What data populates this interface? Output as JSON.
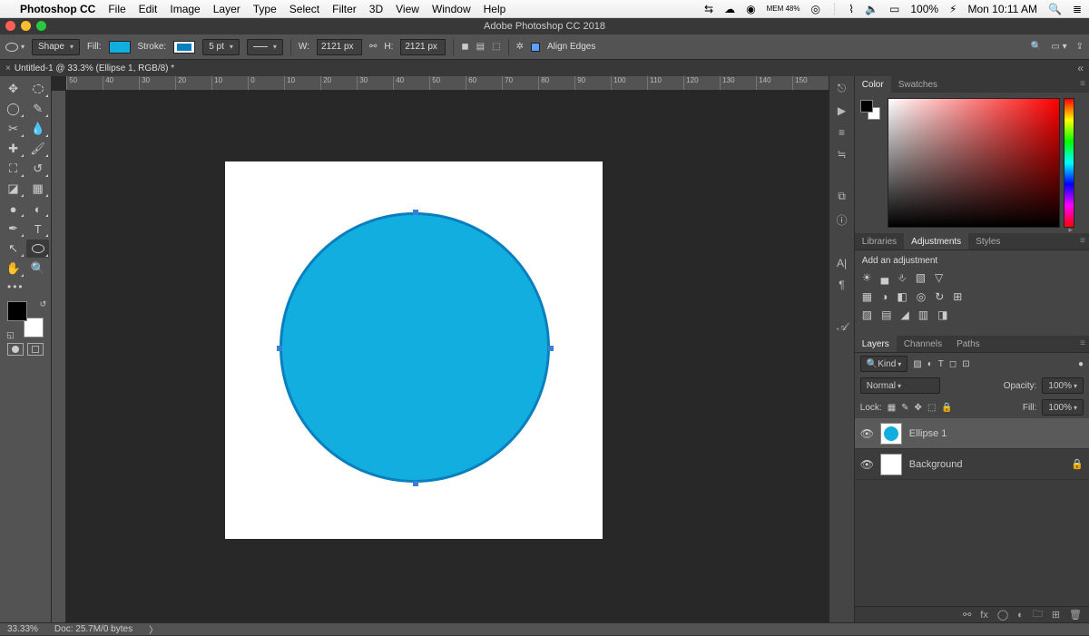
{
  "menubar": {
    "apple": "",
    "app": "Photoshop CC",
    "items": [
      "File",
      "Edit",
      "Image",
      "Layer",
      "Type",
      "Select",
      "Filter",
      "3D",
      "View",
      "Window",
      "Help"
    ],
    "battery": "100%",
    "clock": "Mon 10:11 AM",
    "mem": "MEM 48%"
  },
  "window": {
    "title": "Adobe Photoshop CC 2018"
  },
  "options": {
    "mode": "Shape",
    "fill_label": "Fill:",
    "fill_color": "#12aee0",
    "stroke_label": "Stroke:",
    "stroke_color": "#0a7fbf",
    "stroke_size": "5 pt",
    "w_label": "W:",
    "w_value": "2121 px",
    "h_label": "H:",
    "h_value": "2121 px",
    "align_edges": "Align Edges"
  },
  "document": {
    "tab": "Untitled-1 @ 33.3% (Ellipse 1, RGB/8) *"
  },
  "ruler_h": [
    "50",
    "40",
    "30",
    "20",
    "10",
    "0",
    "10",
    "20",
    "30",
    "40",
    "50",
    "60",
    "70",
    "80",
    "90",
    "100",
    "110",
    "120",
    "130",
    "140",
    "150"
  ],
  "panels": {
    "color_tabs": [
      "Color",
      "Swatches"
    ],
    "lib_tabs": [
      "Libraries",
      "Adjustments",
      "Styles"
    ],
    "add_adjustment": "Add an adjustment",
    "layers_tabs": [
      "Layers",
      "Channels",
      "Paths"
    ],
    "kind": "Kind",
    "blend": "Normal",
    "opacity_label": "Opacity:",
    "opacity": "100%",
    "lock_label": "Lock:",
    "fill_label": "Fill:",
    "fill": "100%",
    "layers": [
      {
        "name": "Ellipse 1",
        "active": true,
        "hasCircle": true
      },
      {
        "name": "Background",
        "active": false,
        "locked": true
      }
    ]
  },
  "status": {
    "zoom": "33.33%",
    "doc": "Doc: 25.7M/0 bytes"
  }
}
